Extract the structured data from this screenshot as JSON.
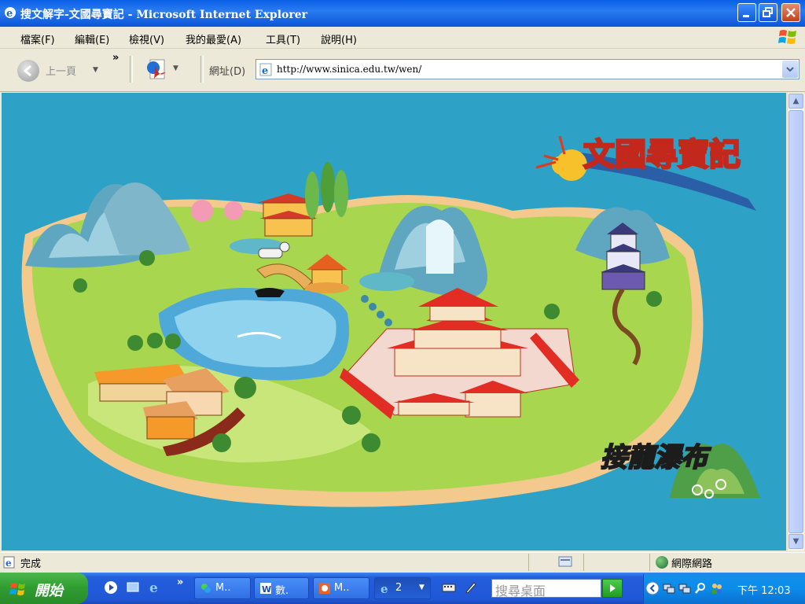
{
  "window": {
    "title": "搜文解字-文國尋寶記 - Microsoft Internet Explorer"
  },
  "menu": {
    "items": [
      "檔案(F)",
      "編輯(E)",
      "檢視(V)",
      "我的最愛(A)",
      "工具(T)",
      "說明(H)"
    ]
  },
  "toolbar": {
    "back_label": "上一頁",
    "more_chevron": "»",
    "address_label": "網址(D)",
    "address_value": "http://www.sinica.edu.tw/wen/"
  },
  "content": {
    "logo_text": "文國尋寶記",
    "location_label": "接龍瀑布",
    "background_color": "#2DA2C6"
  },
  "status": {
    "text": "完成",
    "zone": "網際網路"
  },
  "taskbar": {
    "start_label": "開始",
    "quick_chevron": "»",
    "tasks": [
      {
        "label": "M.."
      },
      {
        "label": "數."
      },
      {
        "label": "M.."
      },
      {
        "label": "2"
      }
    ],
    "search_placeholder": "搜尋桌面",
    "clock": "下午 12:03"
  },
  "colors": {
    "titlebar": "#0A5FE6",
    "taskbar": "#245EDC",
    "start": "#2F9C30",
    "tray": "#0D8BEB"
  }
}
